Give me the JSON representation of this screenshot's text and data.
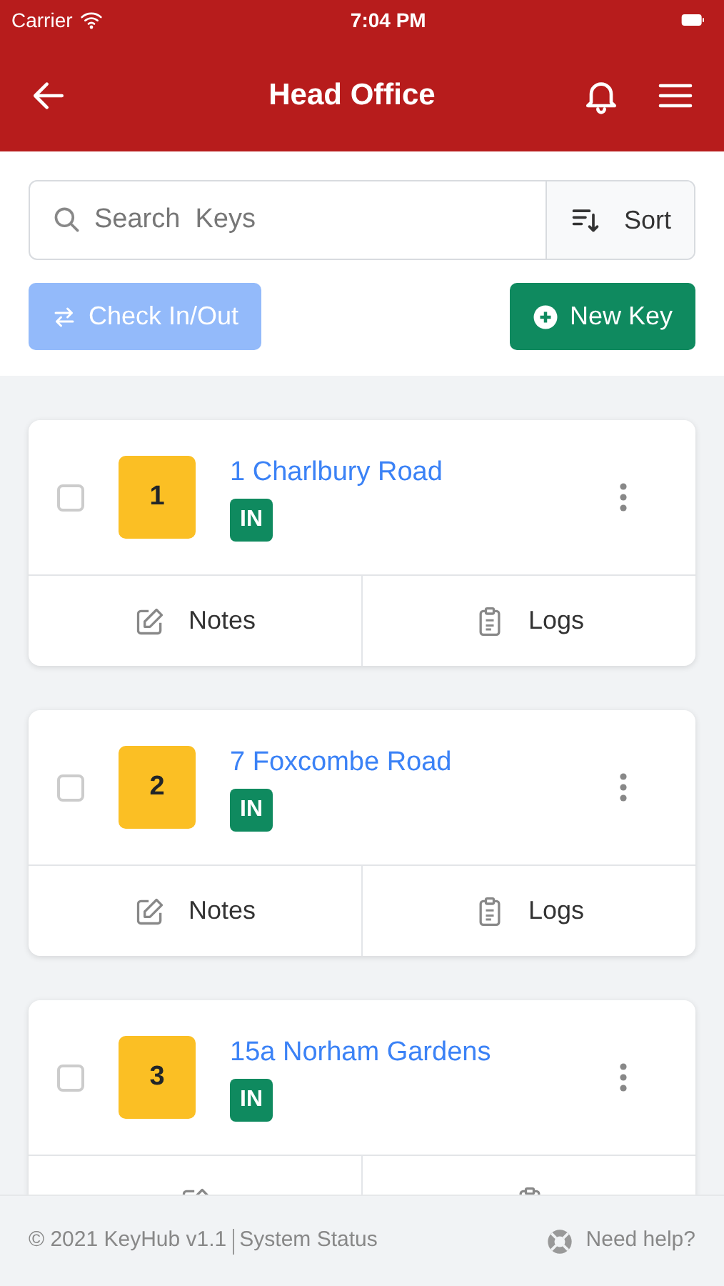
{
  "status_bar": {
    "carrier": "Carrier",
    "time": "7:04 PM"
  },
  "header": {
    "title": "Head Office"
  },
  "search": {
    "placeholder": "Search  Keys",
    "sort_label": "Sort"
  },
  "actions": [
    {
      "label": "Check In/Out",
      "kind": "checkinout",
      "disabled": true
    },
    {
      "label": "New Key",
      "kind": "newkey",
      "disabled": false
    }
  ],
  "keys": [
    {
      "number": "1",
      "name": "1 Charlbury Road",
      "status": "IN",
      "checked": false,
      "actions": [
        {
          "kind": "notes",
          "label": "Notes"
        },
        {
          "kind": "logs",
          "label": "Logs"
        }
      ]
    },
    {
      "number": "2",
      "name": "7 Foxcombe Road",
      "status": "IN",
      "checked": false,
      "actions": [
        {
          "kind": "notes",
          "label": "Notes"
        },
        {
          "kind": "logs",
          "label": "Logs"
        }
      ]
    },
    {
      "number": "3",
      "name": "15a Norham Gardens",
      "status": "IN",
      "checked": false,
      "actions": [
        {
          "kind": "notes"
        },
        {
          "kind": "logs"
        }
      ]
    }
  ],
  "footer": {
    "copyright": "© 2021 KeyHub v1.1",
    "status_link": "System Status",
    "help": "Need help?"
  }
}
